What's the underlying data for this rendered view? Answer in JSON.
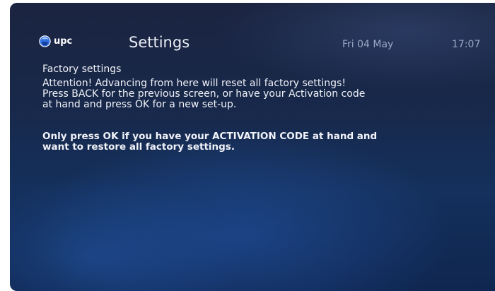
{
  "header": {
    "brand": "upc",
    "title": "Settings",
    "date": "Fri 04 May",
    "time": "17:07"
  },
  "content": {
    "subtitle": "Factory settings",
    "warning_lines": [
      "Attention! Advancing from here will reset all factory settings!",
      "Press BACK for the previous screen, or have your Activation code",
      "at hand and press OK for a new set-up."
    ],
    "note_lines": [
      "Only press OK if you have your ACTIVATION CODE at hand and",
      "want to restore all factory settings."
    ]
  },
  "colors": {
    "background_top": "#1b2440",
    "background_bottom": "#0f2650",
    "logo_blue": "#2f6fe0",
    "text": "#f0f2f8",
    "muted_text": "#9aa6c4"
  },
  "icons": {
    "brand_logo": "upc-logo-icon"
  }
}
